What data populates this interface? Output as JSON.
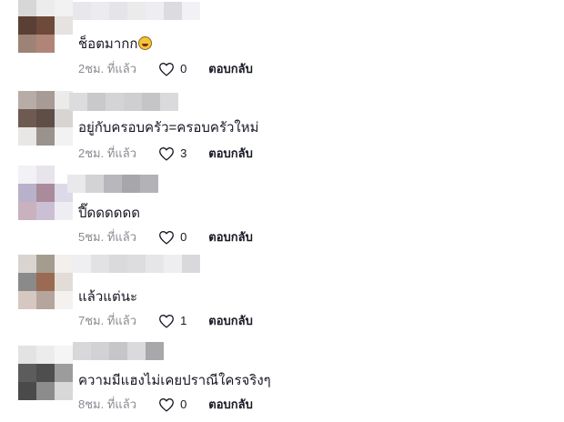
{
  "comments": [
    {
      "text": "ช็อตมากก",
      "emoji": "laughing-emoji",
      "time": "2ชม. ที่แล้ว",
      "likes": "0",
      "reply": "ตอบกลับ",
      "avatar_colors": [
        "#d7d7d7",
        "#ececec",
        "#f2f2f2",
        "#5a4034",
        "#6d4a3a",
        "#e5e2e0",
        "#9d8376",
        "#b08578",
        "#ffffff"
      ],
      "name_colors": [
        "#e8e8ec",
        "#ecebf0",
        "#e5e4e8",
        "#ebebec",
        "#eeeef2",
        "#dcdbe0",
        "#f2f2f6"
      ]
    },
    {
      "text": "อยู่กับครอบครัว=ครอบครัวใหม่",
      "emoji": "",
      "time": "2ชม. ที่แล้ว",
      "likes": "3",
      "reply": "ตอบกลับ",
      "avatar_colors": [
        "#b8aca6",
        "#a89b95",
        "#ecebea",
        "#6e5a50",
        "#5f4e46",
        "#d8d4d2",
        "#e9e7e6",
        "#9a928d",
        "#f3f2f2"
      ],
      "name_colors": [
        "#dcdcde",
        "#c9c9cc",
        "#d4d4d6",
        "#cfcfd1",
        "#c5c5c8",
        "#dadadc"
      ]
    },
    {
      "text": "ปี๊ดดดดดด",
      "emoji": "",
      "time": "5ชม. ที่แล้ว",
      "likes": "0",
      "reply": "ตอบกลับ",
      "avatar_colors": [
        "#f2f1f5",
        "#e7e4ec",
        "#ffffff",
        "#b8b1ca",
        "#a98b9b",
        "#ddd9e8",
        "#c9b1bd",
        "#cbbfd3",
        "#efedf4"
      ],
      "name_colors": [
        "#e9e9eb",
        "#d3d3d6",
        "#b8b8bc",
        "#a6a6ab",
        "#b3b3b7"
      ]
    },
    {
      "text": "แล้วแต่นะ",
      "emoji": "",
      "time": "7ชม. ที่แล้ว",
      "likes": "1",
      "reply": "ตอบกลับ",
      "avatar_colors": [
        "#d9d4d0",
        "#a59c90",
        "#f2efec",
        "#8a8a8a",
        "#9a6a52",
        "#e3dcd6",
        "#d6c8c1",
        "#b5a59d",
        "#f4f1ef"
      ],
      "name_colors": [
        "#efeff1",
        "#e2e2e4",
        "#dadadd",
        "#dddde0",
        "#e6e6e8",
        "#eeeef0",
        "#d9d9dc"
      ]
    },
    {
      "text": "ความมีแฮงไม่เคยปราณีใครจริงๆ",
      "emoji": "",
      "time": "8ชม. ที่แล้ว",
      "likes": "0",
      "reply": "ตอบกลับ",
      "avatar_colors": [
        "#e3e3e3",
        "#ececec",
        "#f5f5f5",
        "#5c5c5c",
        "#4e4e4e",
        "#9c9c9c",
        "#4a4a4a",
        "#8c8c8c",
        "#d8d8d8"
      ],
      "name_colors": [
        "#d8d8da",
        "#d2d2d4",
        "#c6c6c8",
        "#dadadc",
        "#a8a8aa"
      ]
    }
  ]
}
